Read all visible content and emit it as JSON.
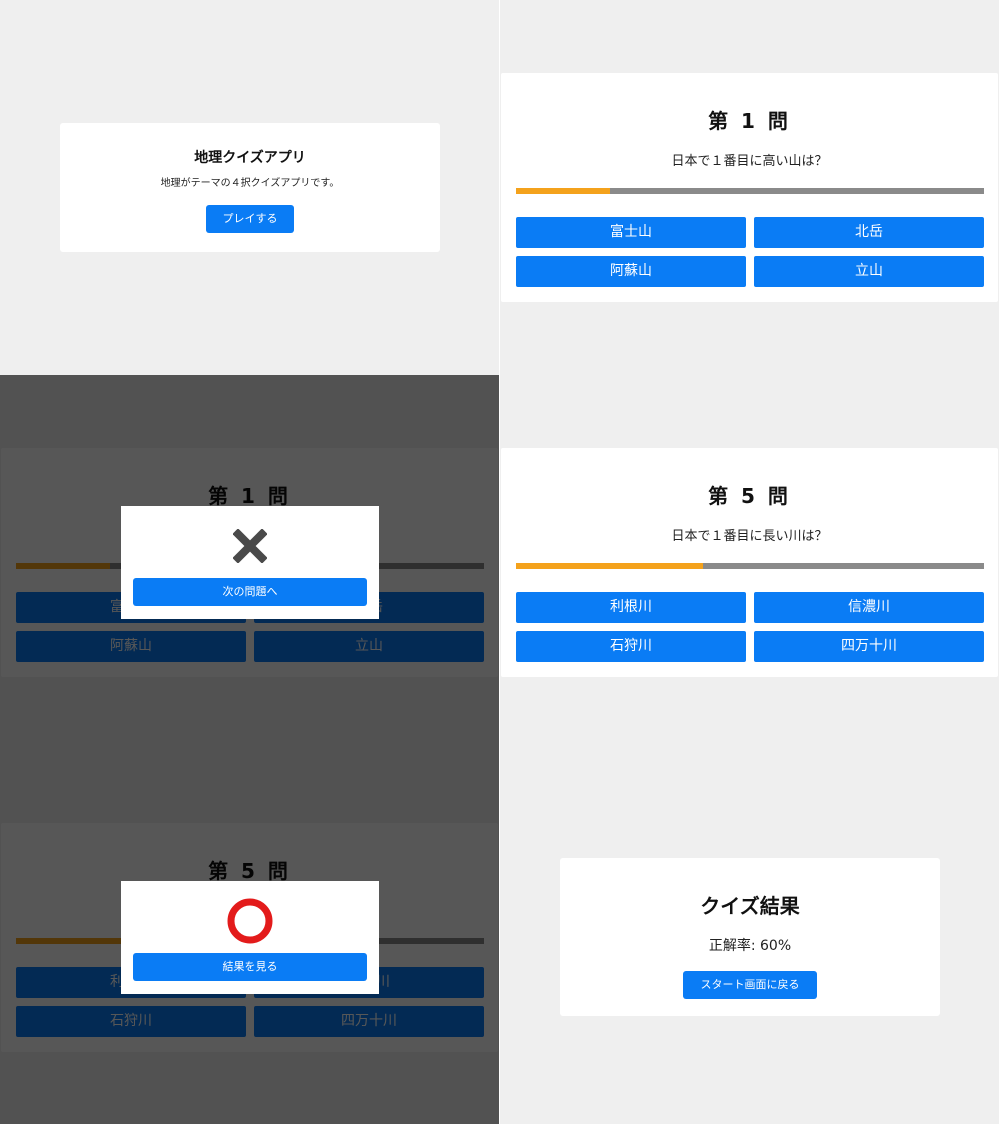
{
  "start": {
    "title": "地理クイズアプリ",
    "description": "地理がテーマの４択クイズアプリです。",
    "play_button": "プレイする"
  },
  "question1": {
    "heading": "第 1 問",
    "text": "日本で１番目に高い山は？",
    "progress": 0.2,
    "choices": [
      "富士山",
      "北岳",
      "阿蘇山",
      "立山"
    ]
  },
  "question5": {
    "heading": "第 5 問",
    "text": "日本で１番目に長い川は？",
    "progress": 0.4,
    "choices": [
      "利根川",
      "信濃川",
      "石狩川",
      "四万十川"
    ]
  },
  "wrong_modal": {
    "icon": "cross-mark-icon",
    "button": "次の問題へ"
  },
  "right_modal": {
    "icon": "circle-mark-icon",
    "button": "結果を見る"
  },
  "result": {
    "title": "クイズ結果",
    "rate": "正解率: 60%",
    "back_button": "スタート画面に戻る"
  },
  "colors": {
    "accent": "#0a7cf5",
    "progress_fill": "#f4a21c",
    "progress_track": "#8a8a8a",
    "wrong_mark": "#4a4a4a",
    "right_mark": "#e31b1b"
  }
}
